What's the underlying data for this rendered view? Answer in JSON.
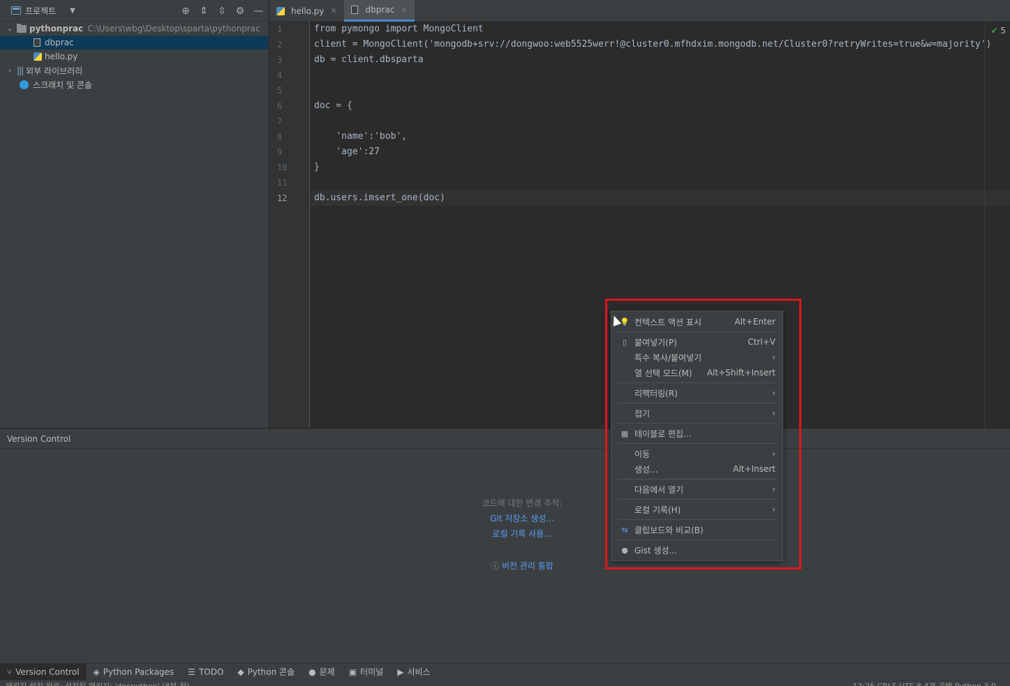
{
  "project_panel": {
    "title": "프로젝트",
    "tree": {
      "root": {
        "label": "pythonprac",
        "path": "C:\\Users\\wbg\\Desktop\\sparta\\pythonprac"
      },
      "files": [
        "dbprac",
        "hello.py"
      ],
      "libraries": "외부 라이브러리",
      "scratches": "스크래치 및 콘솔"
    }
  },
  "editor": {
    "tabs": [
      {
        "label": "hello.py",
        "active": false
      },
      {
        "label": "dbprac",
        "active": true
      }
    ],
    "check_count": "5",
    "line_numbers": [
      "1",
      "2",
      "3",
      "4",
      "5",
      "6",
      "7",
      "8",
      "9",
      "10",
      "11",
      "12"
    ],
    "lines": [
      "from pymongo import MongoClient",
      "client = MongoClient('mongodb+srv://dongwoo:web5525werr!@cluster0.mfhdxim.mongodb.net/Cluster0?retryWrites=true&w=majority')",
      "db = client.dbsparta",
      "",
      "",
      "doc = {",
      "",
      "    'name':'bob',",
      "    'age':27",
      "}",
      "",
      "db.users.imsert_one(doc)"
    ],
    "current_line": 12
  },
  "version_control": {
    "title": "Version Control",
    "hint": "코드에 대한 변경 추적:",
    "link_create_git": "Git 저장소 생성...",
    "link_local_history": "로컬 기록 사용...",
    "link_vcs_integration": "버전 관리 통합"
  },
  "tool_bar": {
    "items": [
      "Version Control",
      "Python Packages",
      "TODO",
      "Python 콘솔",
      "문제",
      "터미널",
      "서비스"
    ]
  },
  "status_bar": {
    "left": "패키지 설치 완료: 설치된 패키지: 'dnspython' (8분 전)",
    "right": "12:25   CRLF   UTF-8   4개 공백   Python 3.9"
  },
  "context_menu": {
    "items": [
      {
        "icon": "lightbulb-icon",
        "label": "컨텍스트 액션 표시",
        "shortcut": "Alt+Enter"
      },
      {
        "icon": "clipboard-icon",
        "label": "붙여넣기(P)",
        "shortcut": "Ctrl+V"
      },
      {
        "icon": "",
        "label": "특수 복사/붙여넣기",
        "shortcut": ""
      },
      {
        "icon": "",
        "label": "열 선택 모드(M)",
        "shortcut": "Alt+Shift+Insert"
      },
      {
        "icon": "",
        "label": "리팩터링(R)",
        "shortcut": ""
      },
      {
        "icon": "",
        "label": "접기",
        "shortcut": ""
      },
      {
        "icon": "table-icon",
        "label": "테이블로 편집...",
        "shortcut": ""
      },
      {
        "icon": "",
        "label": "이동",
        "shortcut": ""
      },
      {
        "icon": "",
        "label": "생성...",
        "shortcut": "Alt+Insert"
      },
      {
        "icon": "",
        "label": "다음에서 열기",
        "shortcut": ""
      },
      {
        "icon": "",
        "label": "로컬 기록(H)",
        "shortcut": ""
      },
      {
        "icon": "compare-icon",
        "label": "클립보드와 비교(B)",
        "shortcut": ""
      },
      {
        "icon": "github-icon",
        "label": "Gist 생성...",
        "shortcut": ""
      }
    ]
  },
  "colors": {
    "accent": "#4a88c7",
    "link": "#589df6",
    "highlight": "#e0151c"
  }
}
